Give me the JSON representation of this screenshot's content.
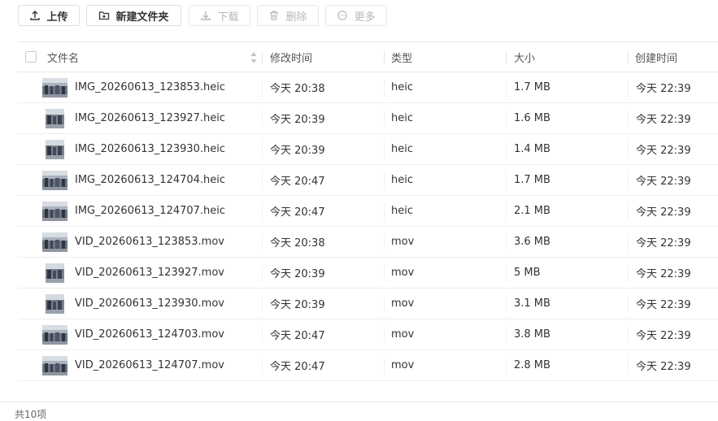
{
  "toolbar": {
    "upload": {
      "label": "上传",
      "icon": "upload-icon"
    },
    "new_folder": {
      "label": "新建文件夹",
      "icon": "folder-plus-icon"
    },
    "download": {
      "label": "下载",
      "icon": "download-icon",
      "disabled": true
    },
    "delete": {
      "label": "删除",
      "icon": "trash-icon",
      "disabled": true
    },
    "more": {
      "label": "更多",
      "icon": "more-icon",
      "disabled": true
    }
  },
  "table": {
    "columns": {
      "name": "文件名",
      "modified": "修改时间",
      "type": "类型",
      "size": "大小",
      "created": "创建时间"
    },
    "rows": [
      {
        "name": "IMG_20260613_123853.heic",
        "modified": "今天 20:38",
        "type": "heic",
        "size": "1.7 MB",
        "created": "今天 22:39",
        "thumb": "landscape"
      },
      {
        "name": "IMG_20260613_123927.heic",
        "modified": "今天 20:39",
        "type": "heic",
        "size": "1.6 MB",
        "created": "今天 22:39",
        "thumb": "portrait"
      },
      {
        "name": "IMG_20260613_123930.heic",
        "modified": "今天 20:39",
        "type": "heic",
        "size": "1.4 MB",
        "created": "今天 22:39",
        "thumb": "portrait"
      },
      {
        "name": "IMG_20260613_124704.heic",
        "modified": "今天 20:47",
        "type": "heic",
        "size": "1.7 MB",
        "created": "今天 22:39",
        "thumb": "landscape"
      },
      {
        "name": "IMG_20260613_124707.heic",
        "modified": "今天 20:47",
        "type": "heic",
        "size": "2.1 MB",
        "created": "今天 22:39",
        "thumb": "landscape"
      },
      {
        "name": "VID_20260613_123853.mov",
        "modified": "今天 20:38",
        "type": "mov",
        "size": "3.6 MB",
        "created": "今天 22:39",
        "thumb": "landscape"
      },
      {
        "name": "VID_20260613_123927.mov",
        "modified": "今天 20:39",
        "type": "mov",
        "size": "5 MB",
        "created": "今天 22:39",
        "thumb": "portrait"
      },
      {
        "name": "VID_20260613_123930.mov",
        "modified": "今天 20:39",
        "type": "mov",
        "size": "3.1 MB",
        "created": "今天 22:39",
        "thumb": "portrait"
      },
      {
        "name": "VID_20260613_124703.mov",
        "modified": "今天 20:47",
        "type": "mov",
        "size": "3.8 MB",
        "created": "今天 22:39",
        "thumb": "landscape"
      },
      {
        "name": "VID_20260613_124707.mov",
        "modified": "今天 20:47",
        "type": "mov",
        "size": "2.8 MB",
        "created": "今天 22:39",
        "thumb": "landscape"
      }
    ]
  },
  "footer": {
    "count_text": "共10项"
  },
  "colors": {
    "border": "#e8e8e8",
    "disabled_text": "#b8b8b8",
    "text": "#333333"
  }
}
